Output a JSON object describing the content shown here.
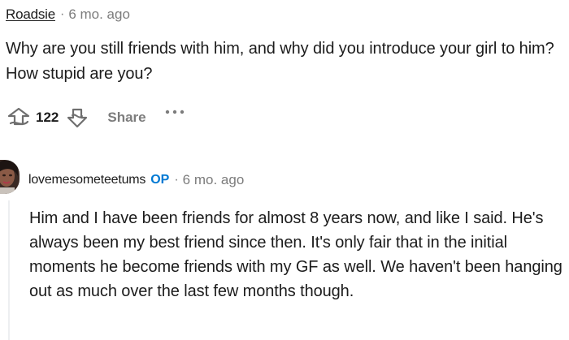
{
  "comments": [
    {
      "author": "Roadsie",
      "separator": "·",
      "time": "6 mo. ago",
      "body": "Why are you still friends with him, and why did you introduce your girl to him? How stupid are you?",
      "vote_count": "122",
      "share_label": "Share",
      "more_label": "···"
    },
    {
      "author": "lovemesometeetums",
      "badge": "OP",
      "separator": "·",
      "time": "6 mo. ago",
      "body": "Him and I have been friends for almost 8 years now, and like I said. He's always been my best friend since then. It's only fair that in the initial moments he become friends with my GF as well. We haven't been hanging out as much over the last few months though."
    }
  ],
  "icons": {
    "upvote": "upvote-icon",
    "downvote": "downvote-icon",
    "more": "more-options-icon",
    "avatar": "user-avatar"
  },
  "colors": {
    "text": "#1c1c1c",
    "meta": "#7c7c7c",
    "op_badge": "#0079d3",
    "thread_line": "#edeff1"
  }
}
